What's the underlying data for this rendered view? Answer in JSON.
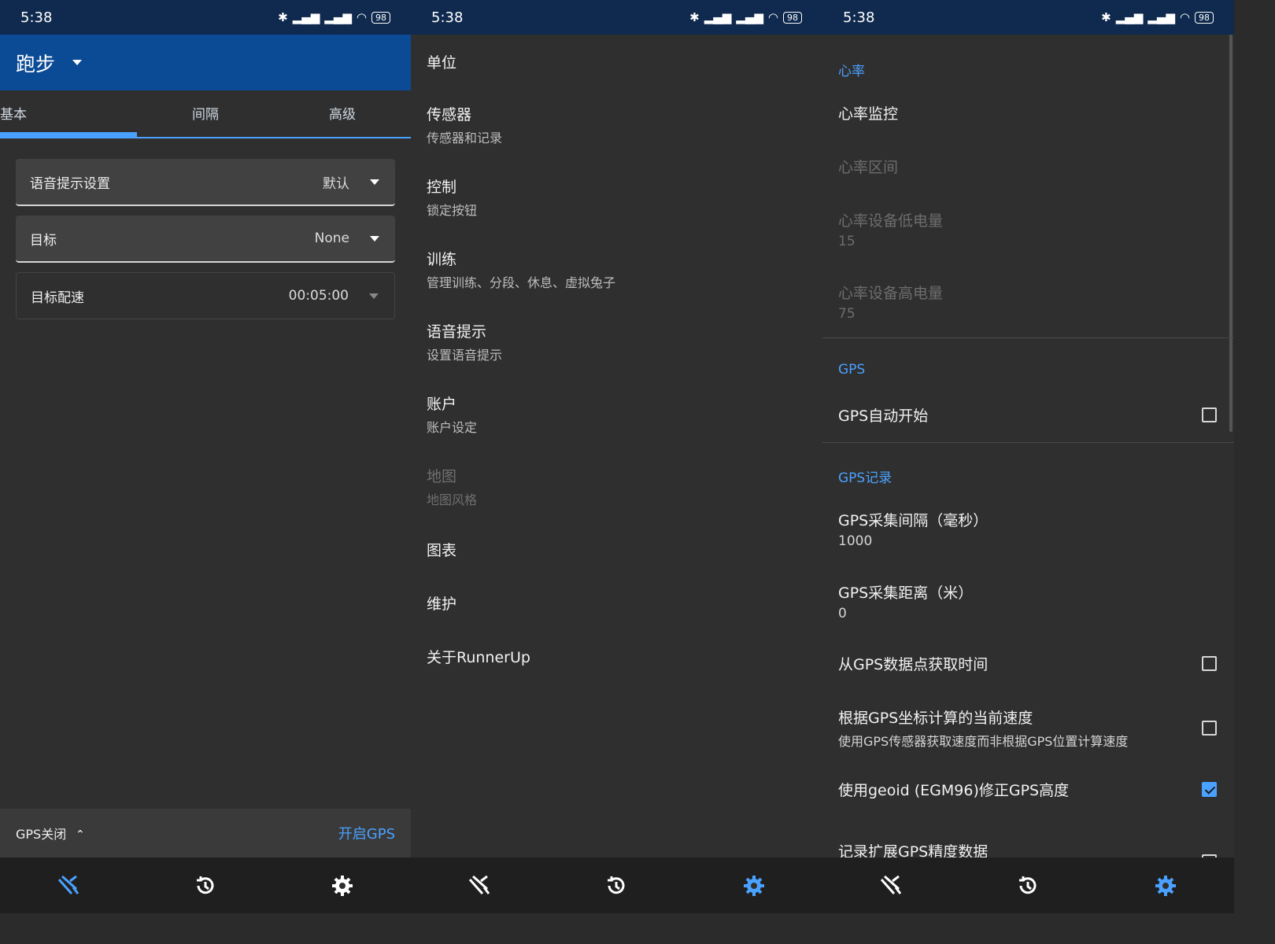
{
  "status": {
    "time": "5:38",
    "battery": "98"
  },
  "phone1": {
    "appbar_title": "跑步",
    "tabs": [
      "基本",
      "间隔",
      "高级"
    ],
    "fields": [
      {
        "label": "语音提示设置",
        "value": "默认"
      },
      {
        "label": "目标",
        "value": "None"
      },
      {
        "label": "目标配速",
        "value": "00:05:00"
      }
    ],
    "gps_status": "GPS关闭",
    "gps_action": "开启GPS"
  },
  "phone2": {
    "items": [
      {
        "title": "单位",
        "subtitle": ""
      },
      {
        "title": "传感器",
        "subtitle": "传感器和记录"
      },
      {
        "title": "控制",
        "subtitle": "锁定按钮"
      },
      {
        "title": "训练",
        "subtitle": "管理训练、分段、休息、虚拟兔子"
      },
      {
        "title": "语音提示",
        "subtitle": "设置语音提示"
      },
      {
        "title": "账户",
        "subtitle": "账户设定"
      },
      {
        "title": "地图",
        "subtitle": "地图风格"
      },
      {
        "title": "图表",
        "subtitle": ""
      },
      {
        "title": "维护",
        "subtitle": ""
      },
      {
        "title": "关于RunnerUp",
        "subtitle": ""
      }
    ]
  },
  "phone3": {
    "cat_heart": "心率",
    "heart_monitor": "心率监控",
    "heart_zone": "心率区间",
    "heart_low": {
      "title": "心率设备低电量",
      "value": "15"
    },
    "heart_high": {
      "title": "心率设备高电量",
      "value": "75"
    },
    "cat_gps": "GPS",
    "gps_autostart": "GPS自动开始",
    "cat_gps_log": "GPS记录",
    "gps_interval": {
      "title": "GPS采集间隔（毫秒）",
      "value": "1000"
    },
    "gps_distance": {
      "title": "GPS采集距离（米）",
      "value": "0"
    },
    "gps_time": "从GPS数据点获取时间",
    "gps_speed": {
      "title": "根据GPS坐标计算的当前速度",
      "value": "使用GPS传感器获取速度而非根据GPS位置计算速度"
    },
    "gps_geoid": "使用geoid (EGM96)修正GPS高度",
    "gps_accuracy": "记录扩展GPS精度数据"
  },
  "colors": {
    "accent": "#4aa1ff",
    "appbar": "#0b4a95",
    "statusbar": "#0f2a4e",
    "background": "#2f2f2f"
  },
  "nav_icons": [
    "run-tools-icon",
    "history-icon",
    "settings-gear-icon"
  ]
}
